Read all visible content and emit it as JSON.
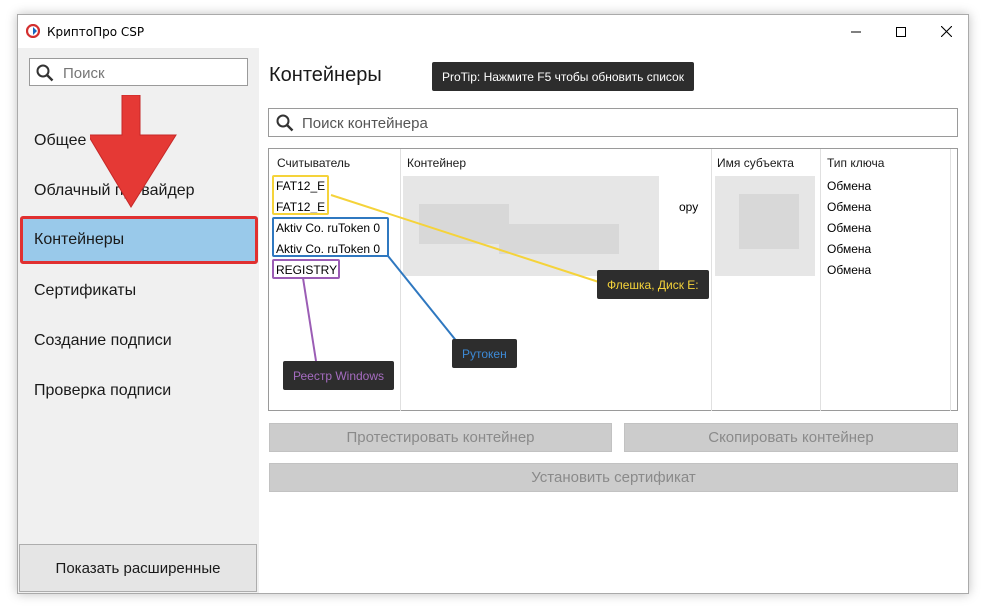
{
  "window": {
    "title": "КриптоПро CSP",
    "controls": {
      "minimize": "minimize-icon",
      "maximize": "maximize-icon",
      "close": "close-icon"
    }
  },
  "sidebar": {
    "search_placeholder": "Поиск",
    "items": [
      {
        "label": "Общее",
        "active": false
      },
      {
        "label": "Облачный провайдер",
        "active": false
      },
      {
        "label": "Контейнеры",
        "active": true
      },
      {
        "label": "Сертификаты",
        "active": false
      },
      {
        "label": "Создание подписи",
        "active": false
      },
      {
        "label": "Проверка подписи",
        "active": false
      }
    ],
    "advanced_button": "Показать расширенные"
  },
  "main": {
    "title": "Контейнеры",
    "protip": "ProTip: Нажмите F5 чтобы обновить список",
    "search_placeholder": "Поиск контейнера",
    "table": {
      "columns": [
        "Считыватель",
        "Контейнер",
        "Имя субъекта",
        "Тип ключа"
      ],
      "rows": [
        {
          "reader": "FAT12_E",
          "container": "",
          "subject": "",
          "key_type": "Обмена"
        },
        {
          "reader": "FAT12_E",
          "container": "ору",
          "subject": "",
          "key_type": "Обмена"
        },
        {
          "reader": "Aktiv Co. ruToken 0",
          "container": "",
          "subject": "",
          "key_type": "Обмена"
        },
        {
          "reader": "Aktiv Co. ruToken 0",
          "container": "",
          "subject": "",
          "key_type": "Обмена"
        },
        {
          "reader": "REGISTRY",
          "container": "",
          "subject": "",
          "key_type": "Обмена"
        }
      ]
    },
    "buttons": {
      "test": "Протестировать контейнер",
      "copy": "Скопировать контейнер",
      "install": "Установить сертификат"
    }
  },
  "annotations": {
    "flash": {
      "text": "Флешка, Диск E:",
      "color": "#f5d33a"
    },
    "rutoken": {
      "text": "Рутокен",
      "color": "#2f78c0"
    },
    "registry": {
      "text": "Реестр Windows",
      "color": "#9b5db5"
    },
    "arrow_color": "#e53935"
  }
}
